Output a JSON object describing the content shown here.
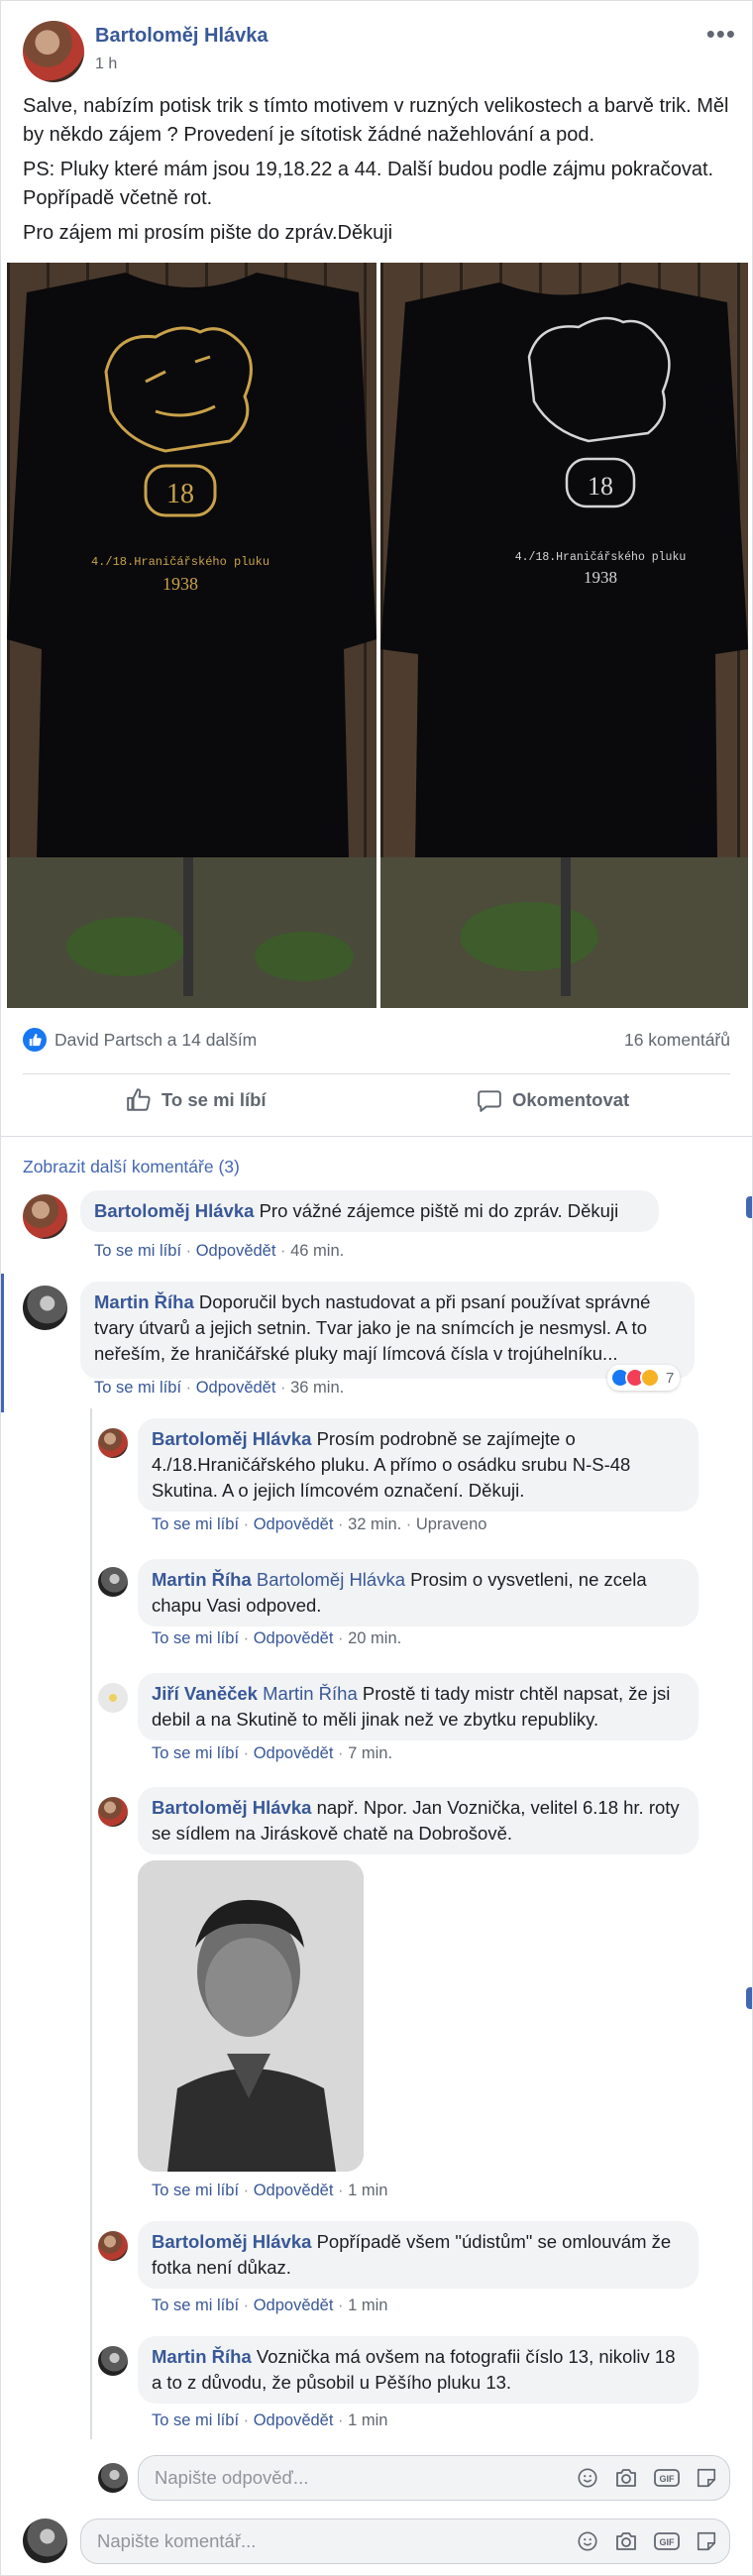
{
  "post": {
    "author": "Bartoloměj Hlávka",
    "time": "1 h",
    "text": [
      "Salve, nabízím potisk trik s tímto motivem v ruzných velikostech a barvě trik. Měl by někdo zájem ? Provedení je sítotisk žádné nažehlování a pod.",
      "PS: Pluky které mám jsou 19,18.22 a 44. Další budou podle zájmu pokračovat. Popřípadě včetně rot.",
      "Pro zájem mi prosím pište do zpráv.Děkuji"
    ],
    "shirt_print": {
      "number": "18",
      "caption": "4./18.Hraničářského pluku",
      "year": "1938",
      "gold": "#c9a24a",
      "silver": "#d5d5d5"
    },
    "likes": "David Partsch a 14 dalším",
    "comments_count": "16 komentářů",
    "like_button": "To se mi líbí",
    "comment_button": "Okomentovat"
  },
  "more_comments": "Zobrazit další komentáře (3)",
  "labels": {
    "like": "To se mi líbí",
    "reply": "Odpovědět",
    "edited": "Upraveno"
  },
  "comments": [
    {
      "author": "Bartoloměj Hlávka",
      "text": "Pro vážné zájemce piště mi do zpráv. Děkuji",
      "time": "46 min."
    },
    {
      "author": "Martin Říha",
      "text": "Doporučil bych nastudovat a při psaní používat správné tvary útvarů a jejich setnin. Tvar jako je na snímcích je nesmysl. A to neřeším, že hraničářské pluky mají límcová čísla v trojúhelníku...",
      "time": "36 min.",
      "reactions": "7"
    }
  ],
  "replies": [
    {
      "author": "Bartoloměj Hlávka",
      "mention": "",
      "text": "Prosím podrobně se zajímejte o 4./18.Hraničářského pluku. A přímo o osádku srubu N-S-48 Skutina. A o jejich límcovém označení. Děkuji.",
      "time": "32 min."
    },
    {
      "author": "Martin Říha",
      "mention": "Bartoloměj Hlávka",
      "text": "Prosim o vysvetleni, ne zcela chapu Vasi odpoved.",
      "time": "20 min."
    },
    {
      "author": "Jiří Vaněček",
      "mention": "Martin Říha",
      "text": "Prostě ti tady mistr chtěl napsat, že jsi debil a na Skutině to měli jinak než ve zbytku republiky.",
      "time": "7 min."
    },
    {
      "author": "Bartoloměj Hlávka",
      "mention": "",
      "text": "např. Npor. Jan Voznička, velitel 6.18 hr. roty se sídlem na Jiráskově chatě na Dobrošově.",
      "time": "1 min"
    },
    {
      "author": "Bartoloměj Hlávka",
      "mention": "",
      "text": "Popřípadě všem \"údistům\" se omlouvám že fotka není důkaz.",
      "time": "1 min"
    },
    {
      "author": "Martin Říha",
      "mention": "",
      "text": "Voznička má ovšem na fotografii číslo 13, nikoliv 18 a to z důvodu, že působil u Pěšího pluku 13.",
      "time": "1 min"
    }
  ],
  "reply_placeholder": "Napište odpověď...",
  "comment_placeholder": "Napište komentář...",
  "icons": [
    "more-options-icon",
    "like-reaction-icon",
    "thumb-up-icon",
    "comment-icon",
    "emoji-icon",
    "camera-icon",
    "gif-icon",
    "sticker-icon"
  ],
  "colors": {
    "link": "#385898",
    "accent": "#4267b2",
    "bubble": "#f2f3f5"
  }
}
